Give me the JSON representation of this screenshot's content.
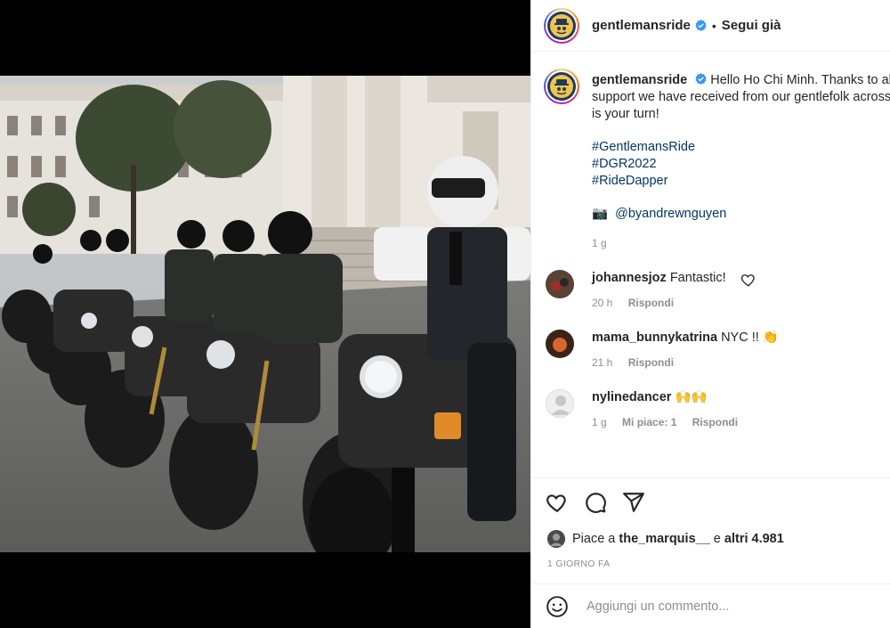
{
  "post": {
    "author": "gentlemansride",
    "follow_state": "Segui già",
    "separator": "•"
  },
  "caption": {
    "text_line1": "Hello Ho Chi Minh. Thanks to all t",
    "text_line2": "support we have received from our gentlefolk across",
    "text_line3": "is your turn!",
    "hashtags": [
      "#GentlemansRide",
      "#DGR2022",
      "#RideDapper"
    ],
    "credit_emoji": "📷",
    "credit": "@byandrewnguyen",
    "time": "1 g"
  },
  "comments": [
    {
      "user": "johannesjoz",
      "text": "Fantastic!",
      "time": "20 h",
      "reply": "Rispondi",
      "avatar_color": "#6b4b3a"
    },
    {
      "user": "mama_bunnykatrina",
      "text": "NYC !! 👏",
      "time": "21 h",
      "reply": "Rispondi",
      "avatar_color": "#b0411f"
    },
    {
      "user": "nylinedancer",
      "text": "🙌🙌",
      "time": "1 g",
      "likes": "Mi piace: 1",
      "reply": "Rispondi",
      "avatar_color": "#e5e5e5"
    }
  ],
  "likes": {
    "prefix": "Piace a",
    "user": "the_marquis__",
    "middle": "e",
    "others": "altri 4.981"
  },
  "timestamp": "1 GIORNO FA",
  "add_comment": {
    "placeholder": "Aggiungi un commento..."
  },
  "colors": {
    "link": "#00376b",
    "muted": "#8e8e8e",
    "verified": "#3897f0"
  }
}
